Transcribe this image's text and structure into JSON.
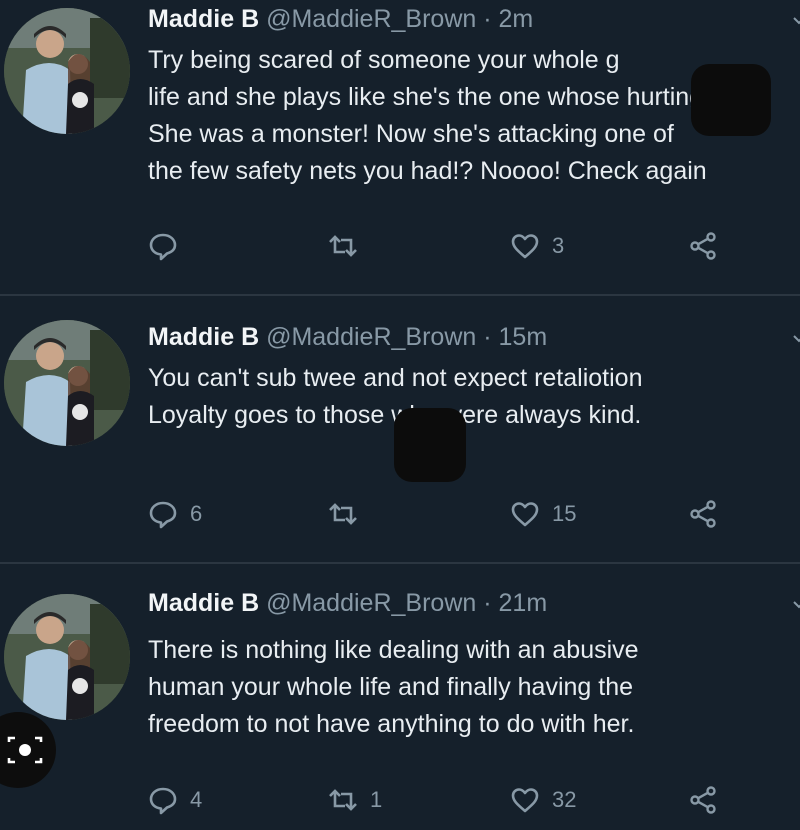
{
  "tweets": [
    {
      "name": "Maddie B",
      "handle": "@MaddieR_Brown",
      "separator": "·",
      "time": "2m",
      "lines": [
        "Try being scared of someone your whole         g",
        "life and she plays like she's the one whose hurting",
        "She was a monster! Now she's attacking one of",
        "the few safety nets you had!? Noooo! Check again"
      ],
      "replies": "",
      "retweets": "",
      "likes": "3"
    },
    {
      "name": "Maddie B",
      "handle": "@MaddieR_Brown",
      "separator": "·",
      "time": "15m",
      "lines": [
        "You can't sub twee          and not expect retaliotion",
        "Loyalty goes to those who were always kind."
      ],
      "replies": "6",
      "retweets": "",
      "likes": "15"
    },
    {
      "name": "Maddie B",
      "handle": "@MaddieR_Brown",
      "separator": "·",
      "time": "21m",
      "lines": [
        "There is nothing like dealing with an abusive",
        "human your whole life and finally having the",
        "freedom to not have anything to do with her."
      ],
      "replies": "4",
      "retweets": "1",
      "likes": "32"
    }
  ],
  "icons": {
    "reply": "reply-icon",
    "retweet": "retweet-icon",
    "like": "heart-icon",
    "share": "share-icon",
    "menu": "chevron-down-icon",
    "camera": "camera-icon"
  },
  "colors": {
    "background": "#15202b",
    "text": "#e8edf1",
    "muted": "#8899a6",
    "divider": "#2b3641"
  }
}
